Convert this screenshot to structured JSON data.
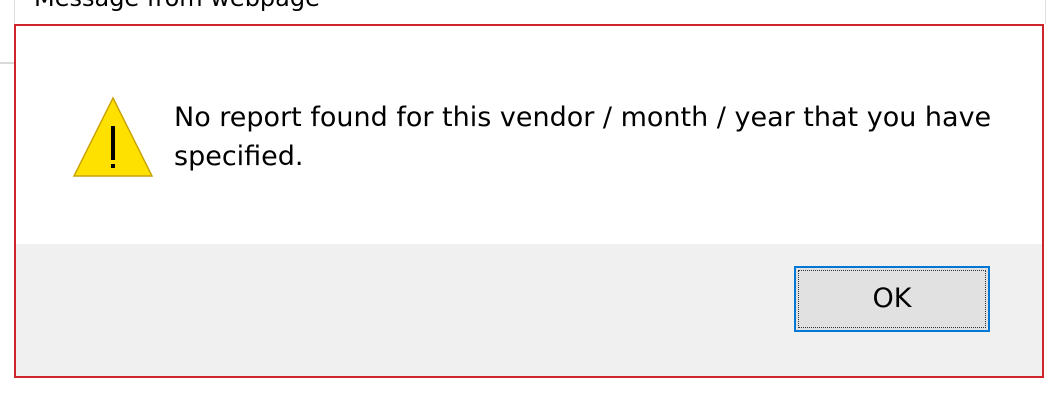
{
  "window": {
    "title": "Message from webpage"
  },
  "dialog": {
    "icon": "warning-icon",
    "message": "No report found for this vendor / month / year that you have specified.",
    "ok_label": "OK"
  },
  "colors": {
    "dialog_border": "#d0232a",
    "button_focus": "#0078d7",
    "warning_fill": "#ffe100",
    "footer_bg": "#f0f0f0"
  }
}
